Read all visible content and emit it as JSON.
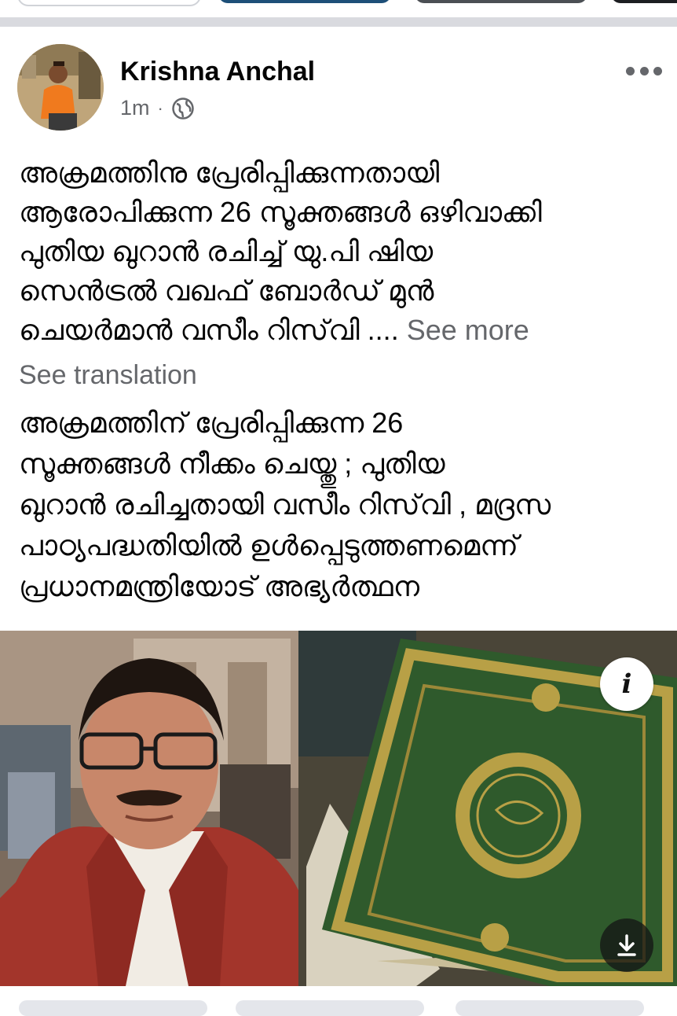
{
  "post": {
    "author": "Krishna Anchal",
    "time": "1m",
    "separator": "·",
    "privacy_icon": "globe-icon",
    "more_icon": "more-horizontal-icon",
    "text_lines": [
      "അക്രമത്തിനു പ്രേരിപ്പിക്കുന്നതായി",
      "ആരോപിക്കുന്ന 26 സൂക്തങ്ങൾ ഒഴിവാക്കി",
      "പുതിയ ഖുറാൻ രചിച്ച് യു.പി ഷിയ",
      "സെൻട്രൽ വഖഫ് ബോർഡ് മുൻ",
      "ചെയർമാൻ വസീം റിസ്‌വി ...."
    ],
    "see_more": "See more",
    "see_translation": "See translation",
    "translation_lines": [
      "അക്രമത്തിന് പ്രേരിപ്പിക്കുന്ന 26",
      "സൂക്തങ്ങൾ നീക്കം ചെയ്തു ; പുതിയ",
      "ഖുറാൻ രചിച്ചതായി വസീം റിസ്‌വി , മദ്രസ",
      "പാഠ്യപദ്ധതിയിൽ ഉൾപ്പെടുത്തണമെന്ന്",
      "പ്രധാനമന്ത്രിയോട് അഭ്യർത്ഥന"
    ],
    "info_icon_label": "i"
  },
  "colors": {
    "text": "#050505",
    "secondary": "#65676b",
    "divider": "#d9dadf",
    "quran_green": "#2f5a2c",
    "gold": "#b8a046",
    "jacket_red": "#a3352b"
  }
}
